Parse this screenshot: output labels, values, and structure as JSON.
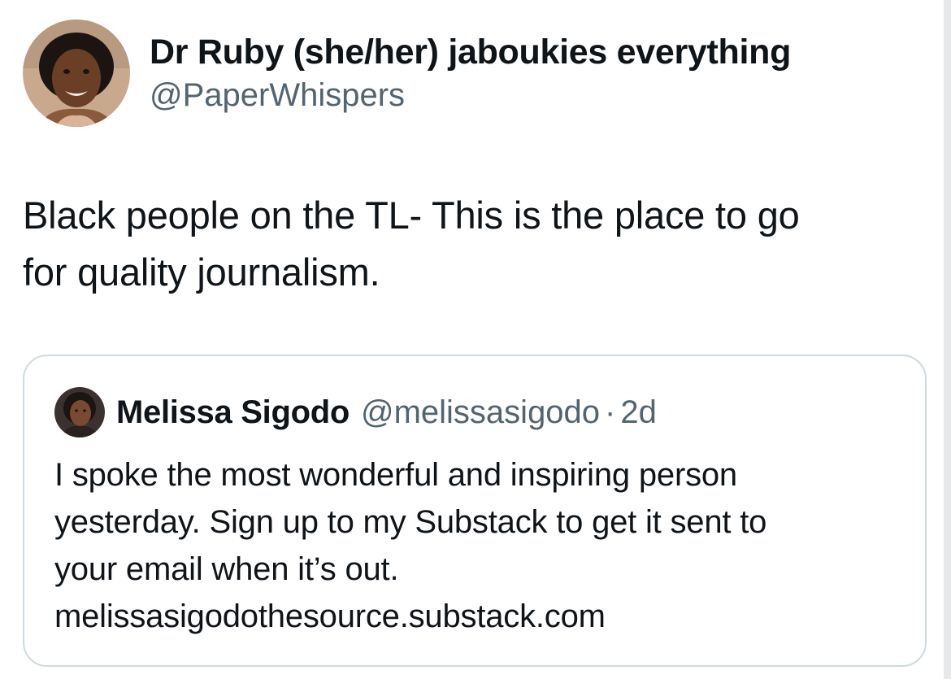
{
  "tweet": {
    "author": {
      "display_name": "Dr Ruby (she/her) jaboukies everything",
      "handle": "@PaperWhispers",
      "avatar_icon": "profile-photo"
    },
    "text_line1": "Black people on the TL- This is the place to go",
    "text_line2": "for quality journalism."
  },
  "quoted_tweet": {
    "author": {
      "display_name": "Melissa Sigodo",
      "handle": "@melissasigodo",
      "separator": "·",
      "time": "2d",
      "avatar_icon": "profile-photo"
    },
    "text_line1": "I spoke the most wonderful and inspiring person",
    "text_line2": "yesterday. Sign up to my Substack to get it sent to",
    "text_line3": "your email when it’s out.",
    "link": "melissasigodothesource.substack.com"
  },
  "colors": {
    "text_primary": "#0f1419",
    "text_secondary": "#536471",
    "border": "#cfd9de"
  }
}
